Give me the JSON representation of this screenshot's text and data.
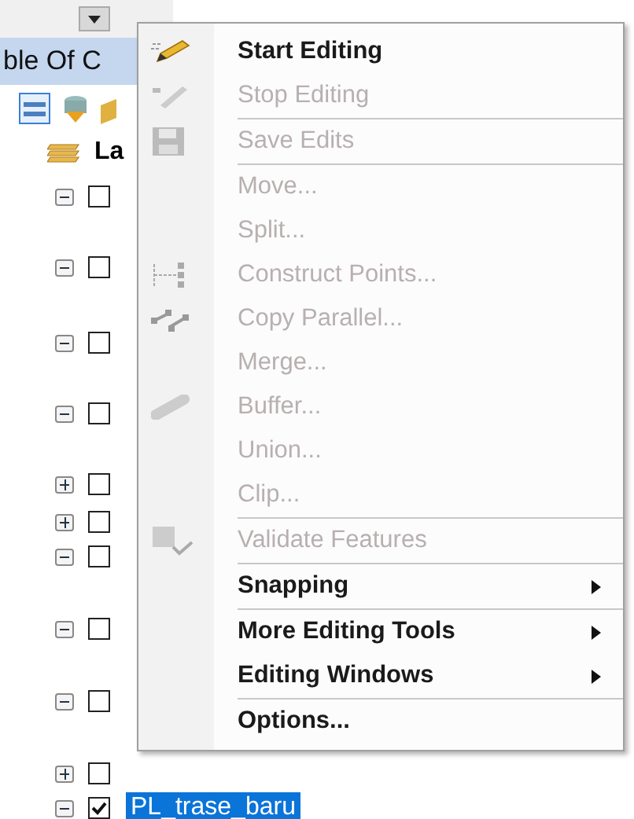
{
  "panel": {
    "title": "ble Of C",
    "layers_label": "La"
  },
  "tree": [
    {
      "expanded": true,
      "checked": false
    },
    {
      "expanded": true,
      "checked": false
    },
    {
      "expanded": true,
      "checked": false
    },
    {
      "expanded": true,
      "checked": false
    },
    {
      "expanded": false,
      "checked": false
    },
    {
      "expanded": false,
      "checked": false
    },
    {
      "expanded": true,
      "checked": false
    },
    {
      "expanded": true,
      "checked": false
    },
    {
      "expanded": true,
      "checked": false
    },
    {
      "expanded": false,
      "checked": false
    },
    {
      "expanded": true,
      "checked": true,
      "label": "PL_trase_baru",
      "selected": true
    }
  ],
  "menu": [
    {
      "kind": "item",
      "label": "Start Editing",
      "disabled": false
    },
    {
      "kind": "item",
      "label": "Stop Editing",
      "disabled": true
    },
    {
      "kind": "separator"
    },
    {
      "kind": "item",
      "label": "Save Edits",
      "disabled": true
    },
    {
      "kind": "separator"
    },
    {
      "kind": "item",
      "label": "Move...",
      "disabled": true
    },
    {
      "kind": "item",
      "label": "Split...",
      "disabled": true
    },
    {
      "kind": "item",
      "label": "Construct Points...",
      "disabled": true
    },
    {
      "kind": "item",
      "label": "Copy Parallel...",
      "disabled": true
    },
    {
      "kind": "item",
      "label": "Merge...",
      "disabled": true
    },
    {
      "kind": "item",
      "label": "Buffer...",
      "disabled": true
    },
    {
      "kind": "item",
      "label": "Union...",
      "disabled": true
    },
    {
      "kind": "item",
      "label": "Clip...",
      "disabled": true
    },
    {
      "kind": "separator"
    },
    {
      "kind": "item",
      "label": "Validate Features",
      "disabled": true
    },
    {
      "kind": "separator"
    },
    {
      "kind": "submenu",
      "label": "Snapping",
      "disabled": false
    },
    {
      "kind": "separator"
    },
    {
      "kind": "submenu",
      "label": "More Editing Tools",
      "disabled": false
    },
    {
      "kind": "submenu",
      "label": "Editing Windows",
      "disabled": false
    },
    {
      "kind": "separator"
    },
    {
      "kind": "item",
      "label": "Options...",
      "disabled": false
    }
  ]
}
